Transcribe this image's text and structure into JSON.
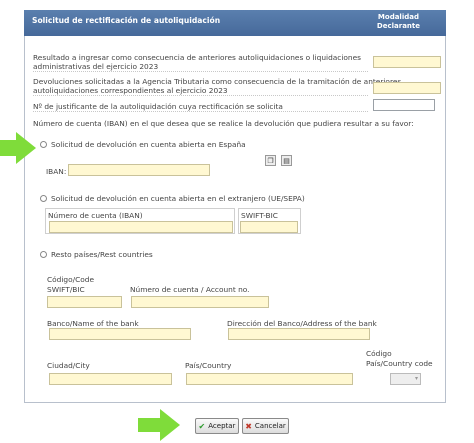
{
  "header": {
    "title": "Solicitud de rectificación de autoliquidación",
    "modalidad": "Modalidad",
    "declarante": "Declarante"
  },
  "rows": {
    "resultado": [
      "Resultado a ingresar como consecuencia de anteriores autoliquidaciones o liquidaciones",
      "administrativas del ejercicio 2023"
    ],
    "devoluciones": [
      "Devoluciones solicitadas a la Agencia Tributaria como consecuencia de la tramitación de anteriores",
      "autoliquidaciones correspondientes al ejercicio 2023"
    ],
    "justificante": "Nº de justificante de la autoliquidación cuya rectificación se solicita",
    "iban_question": "Número de cuenta (IBAN) en el que desea que se realice la devolución que pudiera resultar a su favor:"
  },
  "option_spain": {
    "label": "Solicitud de devolución en cuenta abierta en España",
    "iban_label": "IBAN:"
  },
  "option_foreign": {
    "label": "Solicitud de devolución en cuenta abierta en el extranjero (UE/SEPA)",
    "account_label": "Número de cuenta (IBAN)",
    "swift_label": "SWIFT-BIC"
  },
  "option_rest": {
    "label": "Resto países/Rest countries",
    "code_label_1": "Código/Code",
    "code_label_2": "SWIFT/BIC",
    "account_label": "Número de cuenta / Account no.",
    "bank_label": "Banco/Name of the bank",
    "address_label": "Dirección del Banco/Address of the bank",
    "city_label": "Ciudad/City",
    "country_label": "País/Country",
    "country_code_label_1": "Código",
    "country_code_label_2": "País/Country code"
  },
  "buttons": {
    "accept": "Aceptar",
    "cancel": "Cancelar"
  },
  "colors": {
    "header": "#4f74a5",
    "field": "#fff8d2",
    "arrow": "#7fdc3a"
  }
}
